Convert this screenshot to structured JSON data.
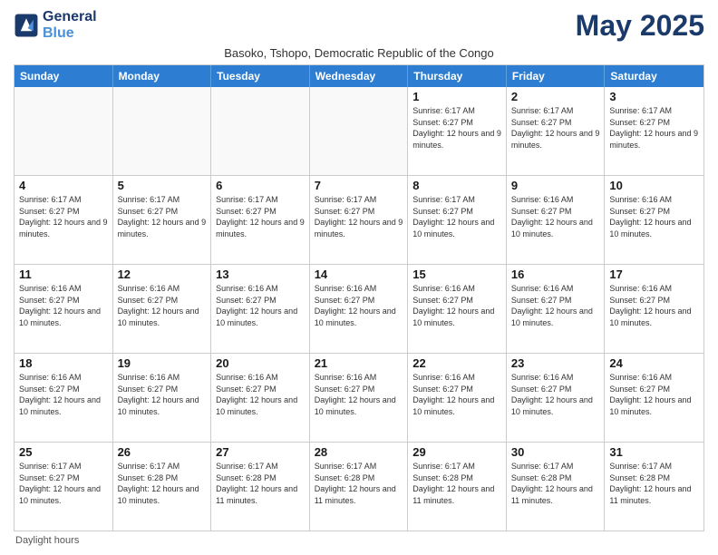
{
  "header": {
    "logo_general": "General",
    "logo_blue": "Blue",
    "month_year": "May 2025",
    "location": "Basoko, Tshopo, Democratic Republic of the Congo"
  },
  "day_headers": [
    "Sunday",
    "Monday",
    "Tuesday",
    "Wednesday",
    "Thursday",
    "Friday",
    "Saturday"
  ],
  "weeks": [
    [
      {
        "day": "",
        "info": "",
        "empty": true
      },
      {
        "day": "",
        "info": "",
        "empty": true
      },
      {
        "day": "",
        "info": "",
        "empty": true
      },
      {
        "day": "",
        "info": "",
        "empty": true
      },
      {
        "day": "1",
        "info": "Sunrise: 6:17 AM\nSunset: 6:27 PM\nDaylight: 12 hours and 9 minutes.",
        "empty": false
      },
      {
        "day": "2",
        "info": "Sunrise: 6:17 AM\nSunset: 6:27 PM\nDaylight: 12 hours and 9 minutes.",
        "empty": false
      },
      {
        "day": "3",
        "info": "Sunrise: 6:17 AM\nSunset: 6:27 PM\nDaylight: 12 hours and 9 minutes.",
        "empty": false
      }
    ],
    [
      {
        "day": "4",
        "info": "Sunrise: 6:17 AM\nSunset: 6:27 PM\nDaylight: 12 hours and 9 minutes.",
        "empty": false
      },
      {
        "day": "5",
        "info": "Sunrise: 6:17 AM\nSunset: 6:27 PM\nDaylight: 12 hours and 9 minutes.",
        "empty": false
      },
      {
        "day": "6",
        "info": "Sunrise: 6:17 AM\nSunset: 6:27 PM\nDaylight: 12 hours and 9 minutes.",
        "empty": false
      },
      {
        "day": "7",
        "info": "Sunrise: 6:17 AM\nSunset: 6:27 PM\nDaylight: 12 hours and 9 minutes.",
        "empty": false
      },
      {
        "day": "8",
        "info": "Sunrise: 6:17 AM\nSunset: 6:27 PM\nDaylight: 12 hours and 10 minutes.",
        "empty": false
      },
      {
        "day": "9",
        "info": "Sunrise: 6:16 AM\nSunset: 6:27 PM\nDaylight: 12 hours and 10 minutes.",
        "empty": false
      },
      {
        "day": "10",
        "info": "Sunrise: 6:16 AM\nSunset: 6:27 PM\nDaylight: 12 hours and 10 minutes.",
        "empty": false
      }
    ],
    [
      {
        "day": "11",
        "info": "Sunrise: 6:16 AM\nSunset: 6:27 PM\nDaylight: 12 hours and 10 minutes.",
        "empty": false
      },
      {
        "day": "12",
        "info": "Sunrise: 6:16 AM\nSunset: 6:27 PM\nDaylight: 12 hours and 10 minutes.",
        "empty": false
      },
      {
        "day": "13",
        "info": "Sunrise: 6:16 AM\nSunset: 6:27 PM\nDaylight: 12 hours and 10 minutes.",
        "empty": false
      },
      {
        "day": "14",
        "info": "Sunrise: 6:16 AM\nSunset: 6:27 PM\nDaylight: 12 hours and 10 minutes.",
        "empty": false
      },
      {
        "day": "15",
        "info": "Sunrise: 6:16 AM\nSunset: 6:27 PM\nDaylight: 12 hours and 10 minutes.",
        "empty": false
      },
      {
        "day": "16",
        "info": "Sunrise: 6:16 AM\nSunset: 6:27 PM\nDaylight: 12 hours and 10 minutes.",
        "empty": false
      },
      {
        "day": "17",
        "info": "Sunrise: 6:16 AM\nSunset: 6:27 PM\nDaylight: 12 hours and 10 minutes.",
        "empty": false
      }
    ],
    [
      {
        "day": "18",
        "info": "Sunrise: 6:16 AM\nSunset: 6:27 PM\nDaylight: 12 hours and 10 minutes.",
        "empty": false
      },
      {
        "day": "19",
        "info": "Sunrise: 6:16 AM\nSunset: 6:27 PM\nDaylight: 12 hours and 10 minutes.",
        "empty": false
      },
      {
        "day": "20",
        "info": "Sunrise: 6:16 AM\nSunset: 6:27 PM\nDaylight: 12 hours and 10 minutes.",
        "empty": false
      },
      {
        "day": "21",
        "info": "Sunrise: 6:16 AM\nSunset: 6:27 PM\nDaylight: 12 hours and 10 minutes.",
        "empty": false
      },
      {
        "day": "22",
        "info": "Sunrise: 6:16 AM\nSunset: 6:27 PM\nDaylight: 12 hours and 10 minutes.",
        "empty": false
      },
      {
        "day": "23",
        "info": "Sunrise: 6:16 AM\nSunset: 6:27 PM\nDaylight: 12 hours and 10 minutes.",
        "empty": false
      },
      {
        "day": "24",
        "info": "Sunrise: 6:16 AM\nSunset: 6:27 PM\nDaylight: 12 hours and 10 minutes.",
        "empty": false
      }
    ],
    [
      {
        "day": "25",
        "info": "Sunrise: 6:17 AM\nSunset: 6:27 PM\nDaylight: 12 hours and 10 minutes.",
        "empty": false
      },
      {
        "day": "26",
        "info": "Sunrise: 6:17 AM\nSunset: 6:28 PM\nDaylight: 12 hours and 10 minutes.",
        "empty": false
      },
      {
        "day": "27",
        "info": "Sunrise: 6:17 AM\nSunset: 6:28 PM\nDaylight: 12 hours and 11 minutes.",
        "empty": false
      },
      {
        "day": "28",
        "info": "Sunrise: 6:17 AM\nSunset: 6:28 PM\nDaylight: 12 hours and 11 minutes.",
        "empty": false
      },
      {
        "day": "29",
        "info": "Sunrise: 6:17 AM\nSunset: 6:28 PM\nDaylight: 12 hours and 11 minutes.",
        "empty": false
      },
      {
        "day": "30",
        "info": "Sunrise: 6:17 AM\nSunset: 6:28 PM\nDaylight: 12 hours and 11 minutes.",
        "empty": false
      },
      {
        "day": "31",
        "info": "Sunrise: 6:17 AM\nSunset: 6:28 PM\nDaylight: 12 hours and 11 minutes.",
        "empty": false
      }
    ]
  ],
  "footer": "Daylight hours"
}
